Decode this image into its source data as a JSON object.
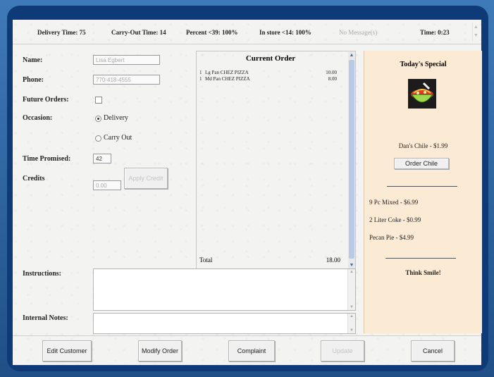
{
  "status": {
    "delivery_time": "Delivery Time: 75",
    "carry_out_time": "Carry-Out Time: 14",
    "percent": "Percent <39: 100%",
    "in_store": "In store <14: 100%",
    "messages": "No Message(s)",
    "time": "Time: 0:23"
  },
  "customer": {
    "name_label": "Name:",
    "name_value": "Lisa Egbert",
    "phone_label": "Phone:",
    "phone_value": "770-418-4555",
    "future_label": "Future Orders:",
    "occasion_label": "Occasion:",
    "occasion_options": [
      "Delivery",
      "Carry Out"
    ],
    "occasion_selected": "Delivery",
    "time_promised_label": "Time Promised:",
    "time_promised_value": "42",
    "credits_label": "Credits",
    "credits_value": "0.00",
    "apply_credit_label": "Apply Credit"
  },
  "order": {
    "title": "Current Order",
    "items": [
      {
        "qty": "1",
        "name": "Lg Pan CHEZ PIZZA",
        "price": "10.00"
      },
      {
        "qty": "1",
        "name": "Md Pan CHEZ PIZZA",
        "price": "8.00"
      }
    ],
    "total_label": "Total",
    "total_value": "18.00"
  },
  "special": {
    "title": "Today's Special",
    "item_text": "Dan's Chile - $1.99",
    "order_button": "Order Chile",
    "deals": [
      "9 Pc Mixed - $6.99",
      "2 Liter Coke - $0.99",
      "Pecan Pie - $4.99"
    ],
    "slogan": "Think Smile!",
    "icon": "chile-bowl-icon"
  },
  "notes": {
    "instructions_label": "Instructions:",
    "internal_label": "Internal Notes:"
  },
  "buttons": {
    "edit_customer": "Edit Customer",
    "modify_order": "Modify Order",
    "complaint": "Complaint",
    "update": "Update",
    "cancel": "Cancel"
  },
  "colors": {
    "frame": "#0e3a78",
    "special_bg": "#fbead4",
    "scroll_thumb": "#b9c9e8"
  }
}
